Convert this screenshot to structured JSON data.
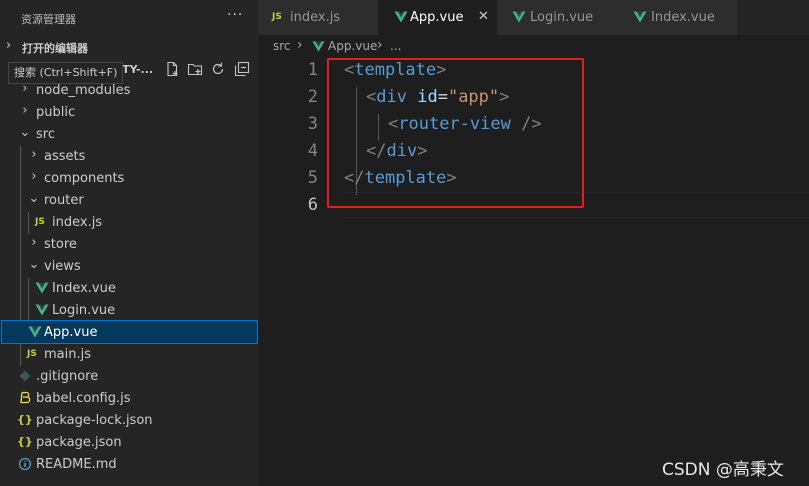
{
  "sidebar": {
    "title": "资源管理器",
    "more": "···",
    "open_editors": "打开的编辑器",
    "tooltip": "搜索 (Ctrl+Shift+F)",
    "project_name": "ITY-...",
    "tree": [
      {
        "label": "node_modules",
        "type": "folder",
        "state": "collapsed"
      },
      {
        "label": "public",
        "type": "folder",
        "state": "collapsed"
      },
      {
        "label": "src",
        "type": "folder",
        "state": "expanded"
      },
      {
        "label": "assets",
        "type": "folder",
        "state": "collapsed"
      },
      {
        "label": "components",
        "type": "folder",
        "state": "collapsed"
      },
      {
        "label": "router",
        "type": "folder",
        "state": "expanded"
      },
      {
        "label": "index.js",
        "type": "js"
      },
      {
        "label": "store",
        "type": "folder",
        "state": "collapsed"
      },
      {
        "label": "views",
        "type": "folder",
        "state": "expanded"
      },
      {
        "label": "Index.vue",
        "type": "vue"
      },
      {
        "label": "Login.vue",
        "type": "vue"
      },
      {
        "label": "App.vue",
        "type": "vue",
        "selected": true
      },
      {
        "label": "main.js",
        "type": "js"
      },
      {
        "label": ".gitignore",
        "type": "git"
      },
      {
        "label": "babel.config.js",
        "type": "babel"
      },
      {
        "label": "package-lock.json",
        "type": "json"
      },
      {
        "label": "package.json",
        "type": "json"
      },
      {
        "label": "README.md",
        "type": "info"
      }
    ]
  },
  "tabs": [
    {
      "label": "index.js",
      "type": "js"
    },
    {
      "label": "App.vue",
      "type": "vue",
      "active": true,
      "close": "✕"
    },
    {
      "label": "Login.vue",
      "type": "vue"
    },
    {
      "label": "Index.vue",
      "type": "vue"
    }
  ],
  "breadcrumb": {
    "folder": "src",
    "sep1": "›",
    "file": "App.vue",
    "sep2": "›",
    "rest": "..."
  },
  "editor": {
    "line_numbers": [
      "1",
      "2",
      "3",
      "4",
      "5",
      "6"
    ],
    "code": {
      "l1": {
        "open": "<",
        "tag": "template",
        "close": ">"
      },
      "l2": {
        "open": "<",
        "tag": "div",
        "attr": "id",
        "eq": "=",
        "val": "\"app\"",
        "close": ">"
      },
      "l3": {
        "open": "<",
        "tag": "router-view",
        "close": " />"
      },
      "l4": {
        "open": "</",
        "tag": "div",
        "close": ">"
      },
      "l5": {
        "open": "</",
        "tag": "template",
        "close": ">"
      }
    }
  },
  "colors": {
    "highlight_box": "#e02020",
    "vue": "#41b883",
    "js": "#cbcb41",
    "selection": "#04395e"
  },
  "watermark": "CSDN @高秉文"
}
